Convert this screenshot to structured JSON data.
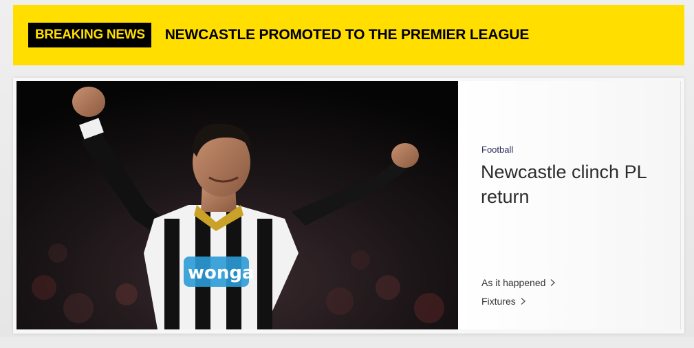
{
  "breaking": {
    "badge": "BREAKING NEWS",
    "headline": "NEWCASTLE PROMOTED TO THE PREMIER LEAGUE"
  },
  "story": {
    "category": "Football",
    "title": "Newcastle clinch PL return",
    "image_shirt_sponsor": "wonga",
    "links": [
      {
        "label": "As it happened",
        "icon": "chevron-right-icon"
      },
      {
        "label": "Fixtures",
        "icon": "chevron-right-icon"
      }
    ]
  },
  "colors": {
    "banner_yellow": "#ffde00",
    "badge_black": "#000000",
    "sponsor_blue": "#2a9bd6"
  }
}
